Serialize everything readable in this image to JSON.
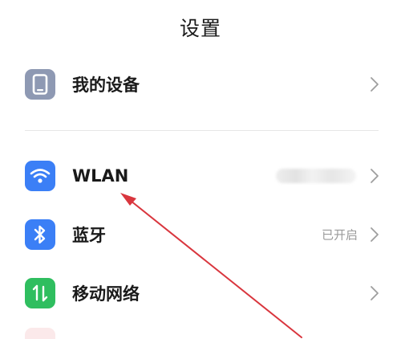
{
  "header": {
    "title": "设置"
  },
  "rows": [
    {
      "id": "my-device",
      "label": "我的设备",
      "status": ""
    },
    {
      "id": "wlan",
      "label": "WLAN",
      "status": ""
    },
    {
      "id": "bluetooth",
      "label": "蓝牙",
      "status": "已开启"
    },
    {
      "id": "mobile-network",
      "label": "移动网络",
      "status": ""
    }
  ],
  "icons": {
    "my_device": "phone-icon",
    "wlan": "wifi-icon",
    "bluetooth": "bluetooth-icon",
    "mobile_network": "mobile-data-icon",
    "chevron": "chevron-right-icon"
  },
  "colors": {
    "device_icon_bg": "#8e99b3",
    "wlan_icon_bg": "#3b7ff6",
    "bluetooth_icon_bg": "#3b7ff6",
    "mobile_icon_bg": "#2fbe5f",
    "annotation_arrow": "#d9363e",
    "status_text": "#9a9a9a"
  }
}
